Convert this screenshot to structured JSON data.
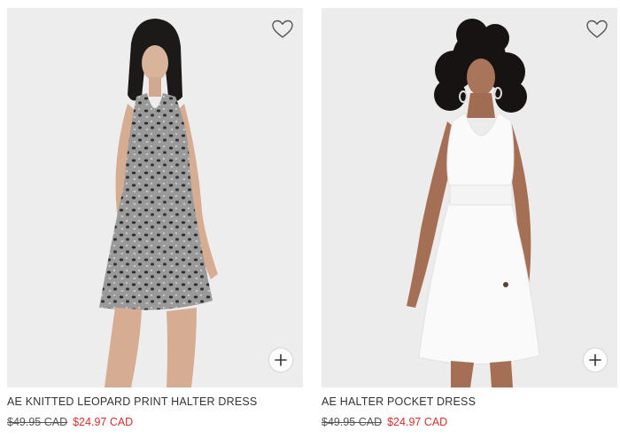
{
  "products": [
    {
      "name": "AE KNITTED LEOPARD PRINT HALTER DRESS",
      "original_price": "$49.95 CAD",
      "sale_price": "$24.97 CAD",
      "dress_color": "#8a8a8a"
    },
    {
      "name": "AE HALTER POCKET DRESS",
      "original_price": "$49.95 CAD",
      "sale_price": "$24.97 CAD",
      "dress_color": "#fafafa"
    }
  ],
  "icons": {
    "favorite": "heart-outline-icon",
    "add": "plus-icon"
  },
  "colors": {
    "sale_price": "#d32f2f",
    "image_background": "#efefef"
  }
}
